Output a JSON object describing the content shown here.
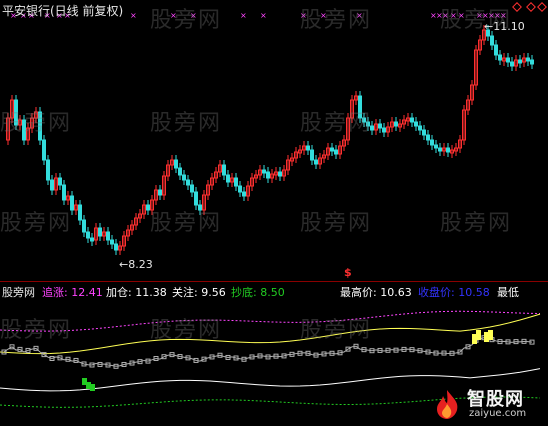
{
  "window": {
    "title": "平安银行(日线 前复权)"
  },
  "main_chart": {
    "high_marker": "11.10",
    "low_marker": "8.23",
    "signal_glyph": "$"
  },
  "indicator_legend": {
    "name": "股旁网",
    "items": [
      {
        "label": "追涨",
        "value": "12.41",
        "color": "#ff44ff"
      },
      {
        "label": "加仓",
        "value": "11.38",
        "color": "#ffffff"
      },
      {
        "label": "关注",
        "value": "9.56",
        "color": "#ffffff"
      },
      {
        "label": "抄底",
        "value": "8.50",
        "color": "#22cc22"
      },
      {
        "label": "最高价",
        "value": "10.63",
        "color": "#ffffff"
      },
      {
        "label": "收盘价",
        "value": "10.58",
        "color": "#3333ff"
      },
      {
        "label": "最低",
        "value": "",
        "color": "#ffffff"
      }
    ]
  },
  "watermark": "股旁网",
  "logo": {
    "word": "智股网",
    "url": "zaiyue.com"
  },
  "colors": {
    "up": "#ff3030",
    "down": "#33dddd",
    "magenta": "#ff44ff",
    "yellow": "#ffff55",
    "gray": "#b0b0b0",
    "green": "#22cc22"
  }
}
